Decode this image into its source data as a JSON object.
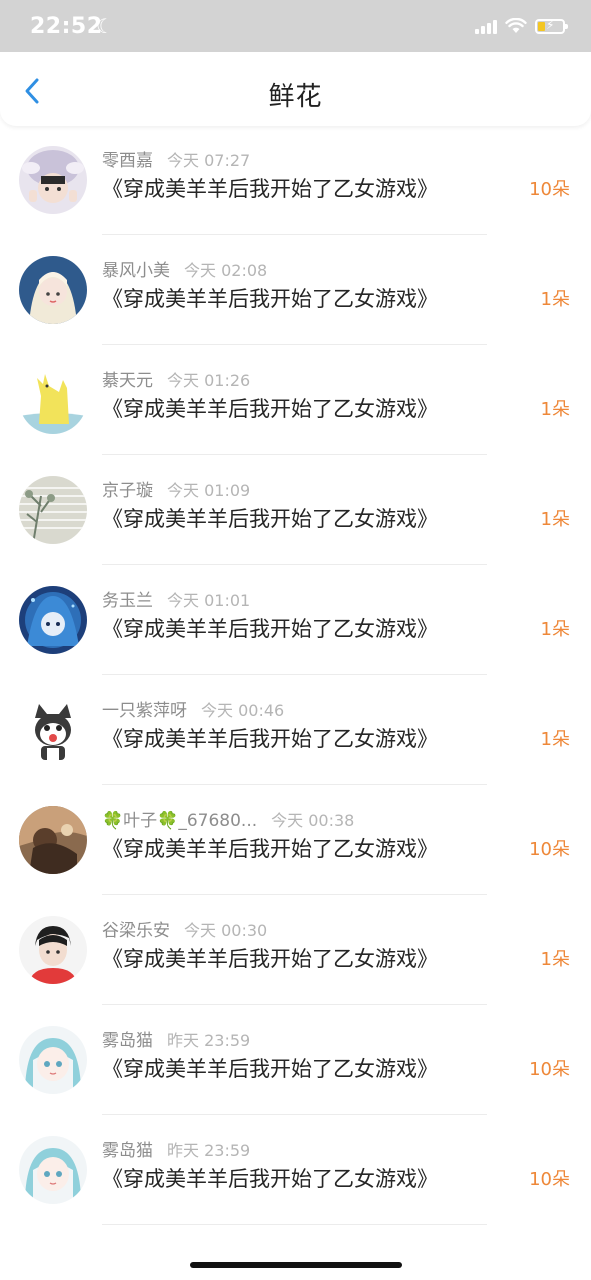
{
  "status_bar": {
    "time": "22:52",
    "moon_glyph": "☾",
    "bolt_glyph": "⚡"
  },
  "nav": {
    "title": "鲜花",
    "back_icon": "chevron-left-icon"
  },
  "colors": {
    "accent_orange": "#ee8839",
    "back_blue": "#2f8fe3",
    "username_gray": "#8d8d8d",
    "timestamp_gray": "#b5b5b5"
  },
  "rows": [
    {
      "username": "",
      "time": "",
      "book": "《穿成美羊羊后我开始了乙女游戏》",
      "count": "10朵"
    },
    {
      "username": "零酉嘉",
      "time": "今天 07:27",
      "book": "《穿成美羊羊后我开始了乙女游戏》",
      "count": "10朵"
    },
    {
      "username": "暴风小美",
      "time": "今天 02:08",
      "book": "《穿成美羊羊后我开始了乙女游戏》",
      "count": "1朵"
    },
    {
      "username": "綦天元",
      "time": "今天 01:26",
      "book": "《穿成美羊羊后我开始了乙女游戏》",
      "count": "1朵"
    },
    {
      "username": "京子璇",
      "time": "今天 01:09",
      "book": "《穿成美羊羊后我开始了乙女游戏》",
      "count": "1朵"
    },
    {
      "username": "务玉兰",
      "time": "今天 01:01",
      "book": "《穿成美羊羊后我开始了乙女游戏》",
      "count": "1朵"
    },
    {
      "username": "一只紫萍呀",
      "time": "今天 00:46",
      "book": "《穿成美羊羊后我开始了乙女游戏》",
      "count": "1朵"
    },
    {
      "username": "🍀叶子🍀_67680...",
      "time": "今天 00:38",
      "book": "《穿成美羊羊后我开始了乙女游戏》",
      "count": "10朵"
    },
    {
      "username": "谷梁乐安",
      "time": "今天 00:30",
      "book": "《穿成美羊羊后我开始了乙女游戏》",
      "count": "1朵"
    },
    {
      "username": "雾岛猫",
      "time": "昨天 23:59",
      "book": "《穿成美羊羊后我开始了乙女游戏》",
      "count": "10朵"
    },
    {
      "username": "雾岛猫",
      "time": "昨天 23:59",
      "book": "《穿成美羊羊后我开始了乙女游戏》",
      "count": "10朵"
    }
  ]
}
